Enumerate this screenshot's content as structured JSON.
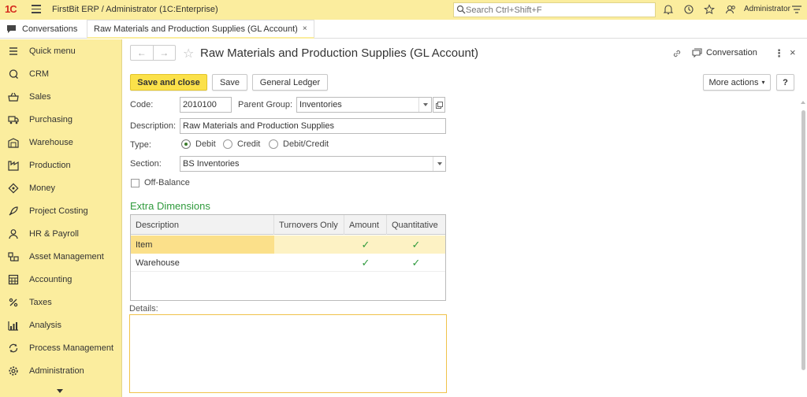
{
  "app": {
    "logo": "1C",
    "title": "FirstBit ERP / Administrator  (1C:Enterprise)",
    "search_placeholder": "Search Ctrl+Shift+F",
    "user": "Administrator"
  },
  "tabs": {
    "home": "Conversations",
    "active": "Raw Materials and Production Supplies (GL Account)",
    "close": "×"
  },
  "sidebar": {
    "items": [
      {
        "label": "Quick menu",
        "icon": "menu-icon"
      },
      {
        "label": "CRM",
        "icon": "chat-icon"
      },
      {
        "label": "Sales",
        "icon": "basket-icon"
      },
      {
        "label": "Purchasing",
        "icon": "truck-icon"
      },
      {
        "label": "Warehouse",
        "icon": "warehouse-icon"
      },
      {
        "label": "Production",
        "icon": "factory-icon"
      },
      {
        "label": "Money",
        "icon": "money-icon"
      },
      {
        "label": "Project Costing",
        "icon": "rocket-icon"
      },
      {
        "label": "HR & Payroll",
        "icon": "person-icon"
      },
      {
        "label": "Asset Management",
        "icon": "asset-icon"
      },
      {
        "label": "Accounting",
        "icon": "calculator-icon"
      },
      {
        "label": "Taxes",
        "icon": "percent-icon"
      },
      {
        "label": "Analysis",
        "icon": "bar-chart-icon"
      },
      {
        "label": "Process Management",
        "icon": "cycle-icon"
      },
      {
        "label": "Administration",
        "icon": "gear-icon"
      }
    ]
  },
  "form": {
    "title": "Raw Materials and Production Supplies (GL Account)",
    "conversation_label": "Conversation",
    "more_dots": "⋮",
    "close": "×",
    "buttons": {
      "save_and_close": "Save and close",
      "save": "Save",
      "general_ledger": "General Ledger",
      "more_actions": "More actions",
      "help": "?"
    },
    "code_label": "Code:",
    "code_value": "2010100",
    "parent_group_label": "Parent Group:",
    "parent_group_value": "Inventories",
    "description_label": "Description:",
    "description_value": "Raw Materials and Production Supplies",
    "type_label": "Type:",
    "type_options": [
      "Debit",
      "Credit",
      "Debit/Credit"
    ],
    "type_selected": "Debit",
    "section_label": "Section:",
    "section_value": "BS Inventories",
    "off_balance_label": "Off-Balance",
    "off_balance_checked": false,
    "extra_dimensions_title": "Extra Dimensions",
    "table": {
      "columns": [
        "Description",
        "Turnovers Only",
        "Amount",
        "Quantitative"
      ],
      "rows": [
        {
          "description": "Item",
          "turnovers_only": false,
          "amount": true,
          "quantitative": true
        },
        {
          "description": "Warehouse",
          "turnovers_only": false,
          "amount": true,
          "quantitative": true
        }
      ],
      "check_mark": "✓"
    },
    "details_label": "Details:",
    "details_value": ""
  },
  "colors": {
    "panel_yellow": "#fbed9e",
    "primary_button": "#fbe14a",
    "group_green": "#2f9a3c",
    "selected_row": "#fbe08a"
  }
}
